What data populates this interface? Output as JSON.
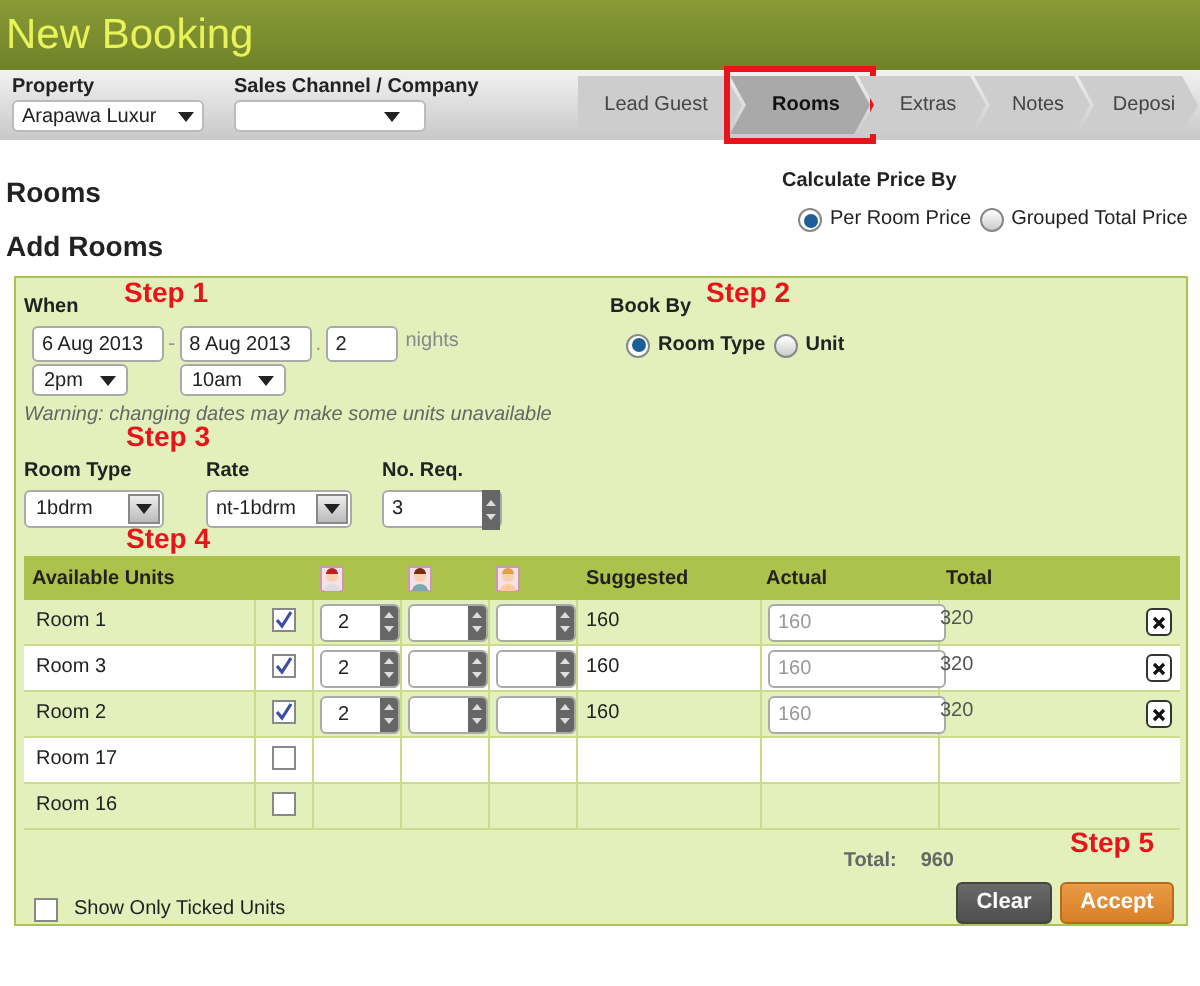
{
  "header": {
    "title": "New Booking"
  },
  "toolbar": {
    "property": {
      "label": "Property",
      "value": "Arapawa Luxur"
    },
    "sales_channel": {
      "label": "Sales Channel / Company"
    }
  },
  "tabs": [
    {
      "label": "Lead Guest",
      "selected": false,
      "highlighted": false
    },
    {
      "label": "Rooms",
      "selected": true,
      "highlighted": true
    },
    {
      "label": "Extras",
      "selected": false,
      "highlighted": false
    },
    {
      "label": "Notes",
      "selected": false,
      "highlighted": false
    },
    {
      "label": "Deposi",
      "selected": false,
      "highlighted": false
    }
  ],
  "headings": [
    "Rooms",
    "Add Rooms"
  ],
  "price_by": {
    "label": "Calculate Price By",
    "options": [
      {
        "label": "Per Room Price",
        "selected": true
      },
      {
        "label": "Grouped Total Price",
        "selected": false
      }
    ]
  },
  "when": {
    "label": "When",
    "arrival": "6 Aug 2013",
    "separator_1": "-",
    "departure": "8 Aug 2013",
    "separator_2": ".",
    "nights": "2",
    "nights_label": "nights",
    "arrival_time": "2pm",
    "departure_time": "10am"
  },
  "book_by": {
    "label": "Book By",
    "options": [
      {
        "label": "Room Type",
        "selected": true
      },
      {
        "label": "Unit",
        "selected": false
      }
    ]
  },
  "warning": "Warning: changing dates may make some units unavailable",
  "room_type": {
    "label": "Room Type",
    "value": "1bdrm"
  },
  "rate": {
    "label": "Rate",
    "value": "nt-1bdrm"
  },
  "no_req": {
    "label": "No. Req.",
    "value": "3"
  },
  "columns": {
    "units": "Available Units",
    "suggested": "Suggested",
    "actual": "Actual",
    "total": "Total"
  },
  "rows": [
    {
      "name": "Room 1",
      "checked": true,
      "adults": "2",
      "suggested": "160",
      "actual_placeholder": "160",
      "total": "320"
    },
    {
      "name": "Room 3",
      "checked": true,
      "adults": "2",
      "suggested": "160",
      "actual_placeholder": "160",
      "total": "320"
    },
    {
      "name": "Room 2",
      "checked": true,
      "adults": "2",
      "suggested": "160",
      "actual_placeholder": "160",
      "total": "320"
    },
    {
      "name": "Room 17",
      "checked": false
    },
    {
      "name": "Room 16",
      "checked": false
    }
  ],
  "total": {
    "label": "Total:",
    "value": "960"
  },
  "show_only_ticked": {
    "label": "Show Only Ticked Units",
    "checked": false
  },
  "buttons": [
    {
      "label": "Clear",
      "kind": "secondary"
    },
    {
      "label": "Accept",
      "kind": "primary"
    }
  ],
  "annotations": [
    "Step 1",
    "Step 2",
    "Step 3",
    "Step 4",
    "Step 5"
  ]
}
